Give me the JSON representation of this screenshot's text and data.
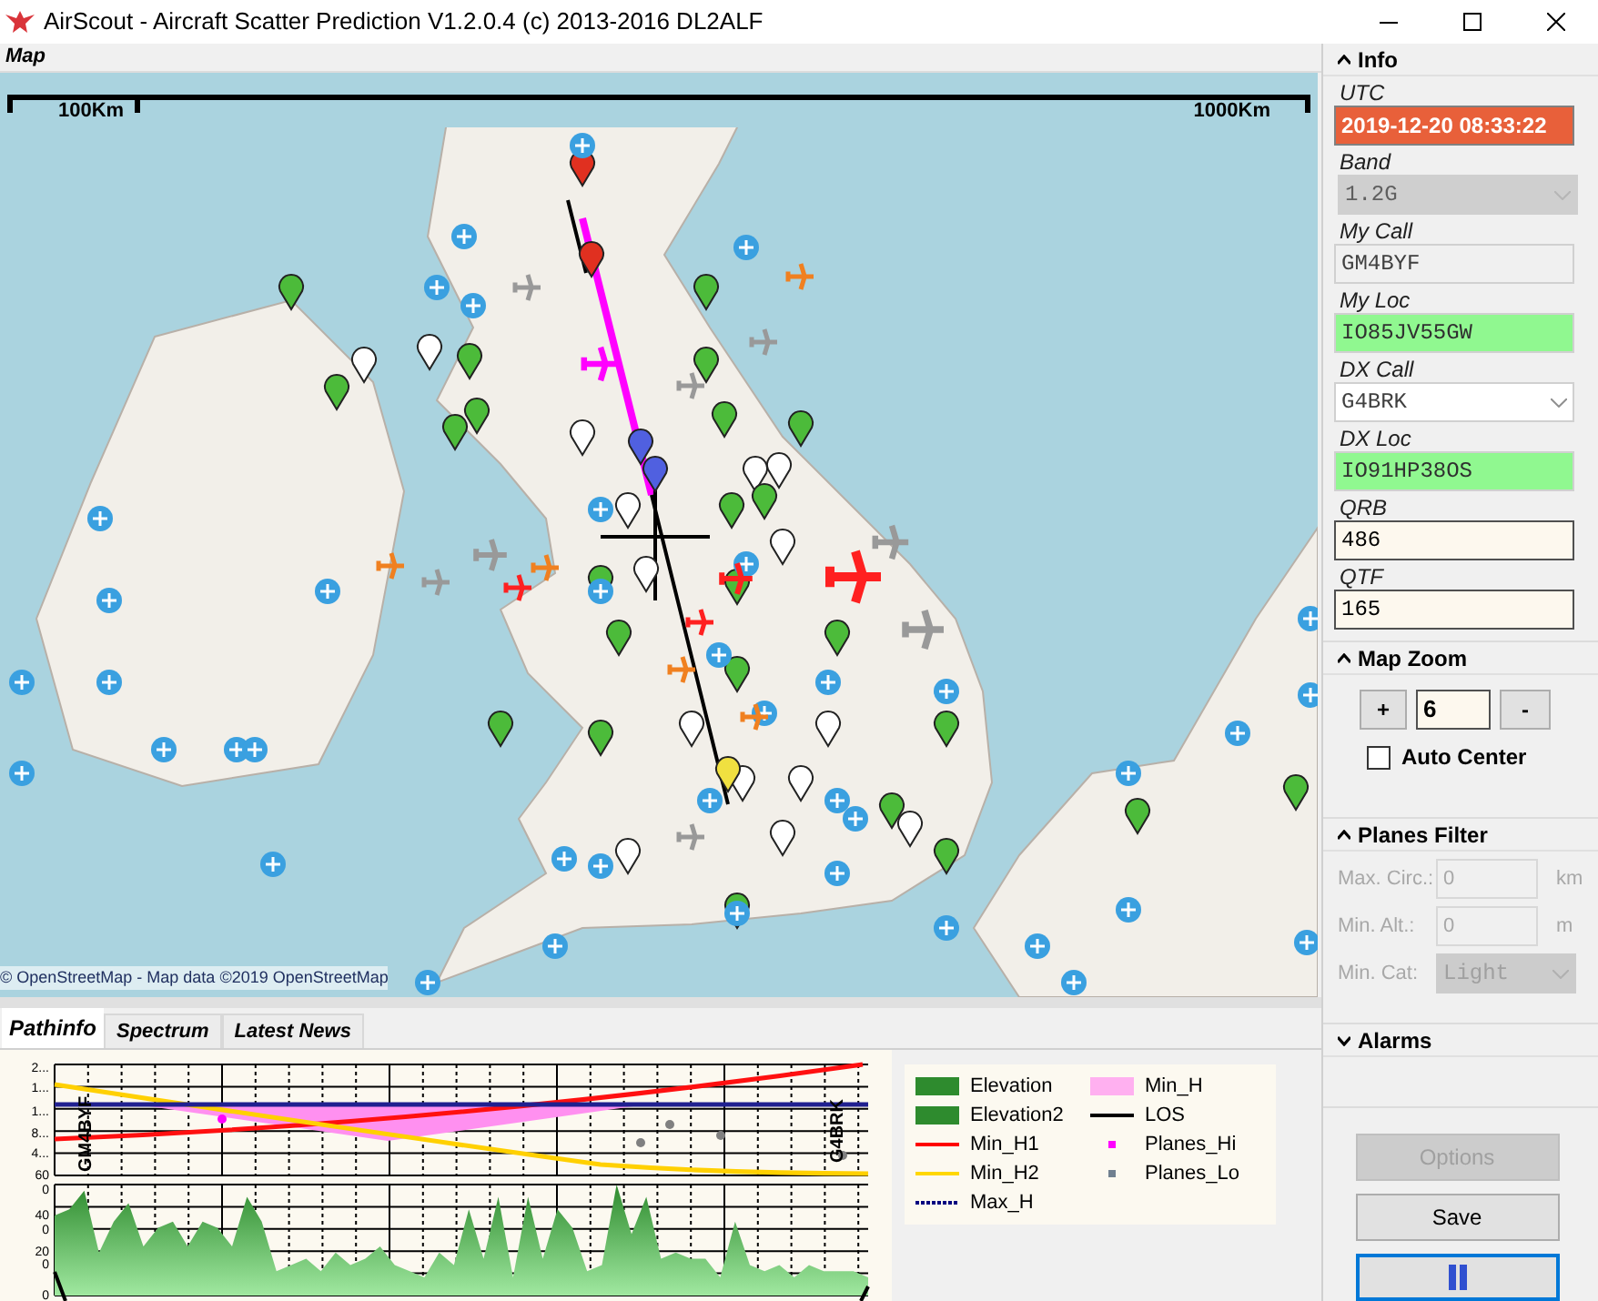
{
  "window": {
    "title": "AirScout - Aircraft Scatter Prediction V1.2.0.4 (c) 2013-2016 DL2ALF"
  },
  "map": {
    "title": "Map",
    "scale_left": "100Km",
    "scale_right": "1000Km",
    "attribution": "© OpenStreetMap - Map data ©2019 OpenStreetMap"
  },
  "bottom_tabs": [
    {
      "label": "Pathinfo",
      "selected": true
    },
    {
      "label": "Spectrum",
      "selected": false
    },
    {
      "label": "Latest News",
      "selected": false
    }
  ],
  "pathinfo": {
    "top_axis_labels": [
      "2...",
      "1...",
      "1...",
      "8...",
      "4...",
      "60"
    ],
    "bottom_axis_labels": [
      "0",
      "40",
      "0",
      "20",
      "0",
      "0"
    ],
    "left_call": "GM4BYF",
    "right_call": "G4BRK",
    "legend": [
      {
        "label": "Elevation",
        "kind": "area",
        "color": "#2e8b2e"
      },
      {
        "label": "Elevation2",
        "kind": "area",
        "color": "#2e8b2e"
      },
      {
        "label": "Min_H1",
        "kind": "line",
        "color": "#ff0000"
      },
      {
        "label": "Min_H2",
        "kind": "line",
        "color": "#ffd700"
      },
      {
        "label": "Max_H",
        "kind": "dotted",
        "color": "#000080"
      },
      {
        "label": "Min_H",
        "kind": "fill",
        "color": "#ffb0f0"
      },
      {
        "label": "LOS",
        "kind": "line",
        "color": "#000000"
      },
      {
        "label": "Planes_Hi",
        "kind": "dot",
        "color": "#ff00ff"
      },
      {
        "label": "Planes_Lo",
        "kind": "dot",
        "color": "#708090"
      }
    ]
  },
  "sidebar": {
    "sections": [
      {
        "title": "Info",
        "expanded": true,
        "fields": [
          {
            "label": "UTC",
            "value": "2019-12-20 08:33:22",
            "kind": "clock",
            "disabled": false
          },
          {
            "label": "Band",
            "value": "1.2G",
            "kind": "dropdown",
            "disabled": true
          },
          {
            "label": "My Call",
            "value": "GM4BYF",
            "kind": "readonly",
            "disabled": false
          },
          {
            "label": "My Loc",
            "value": "IO85JV55GW",
            "kind": "locator",
            "disabled": false
          },
          {
            "label": "DX Call",
            "value": "G4BRK",
            "kind": "combo",
            "disabled": false
          },
          {
            "label": "DX Loc",
            "value": "IO91HP38OS",
            "kind": "locator",
            "disabled": false
          },
          {
            "label": "QRB",
            "value": "486",
            "kind": "entry",
            "disabled": false
          },
          {
            "label": "QTF",
            "value": "165",
            "kind": "entry",
            "disabled": false
          }
        ]
      },
      {
        "title": "Map Zoom",
        "expanded": true,
        "zoom_in": "+",
        "zoom_value": "6",
        "zoom_out": "-",
        "auto_center": {
          "label": "Auto Center",
          "checked": false
        }
      },
      {
        "title": "Planes Filter",
        "expanded": true,
        "filters": [
          {
            "label": "Max. Circ.:",
            "value": "0",
            "unit": "km",
            "kind": "entry"
          },
          {
            "label": "Min. Alt.:",
            "value": "0",
            "unit": "m",
            "kind": "entry"
          },
          {
            "label": "Min. Cat:",
            "value": "Light",
            "kind": "dropdown"
          }
        ]
      },
      {
        "title": "Alarms",
        "expanded": false
      }
    ],
    "buttons": [
      {
        "label": "Options",
        "disabled": true
      },
      {
        "label": "Save",
        "disabled": false
      }
    ]
  }
}
